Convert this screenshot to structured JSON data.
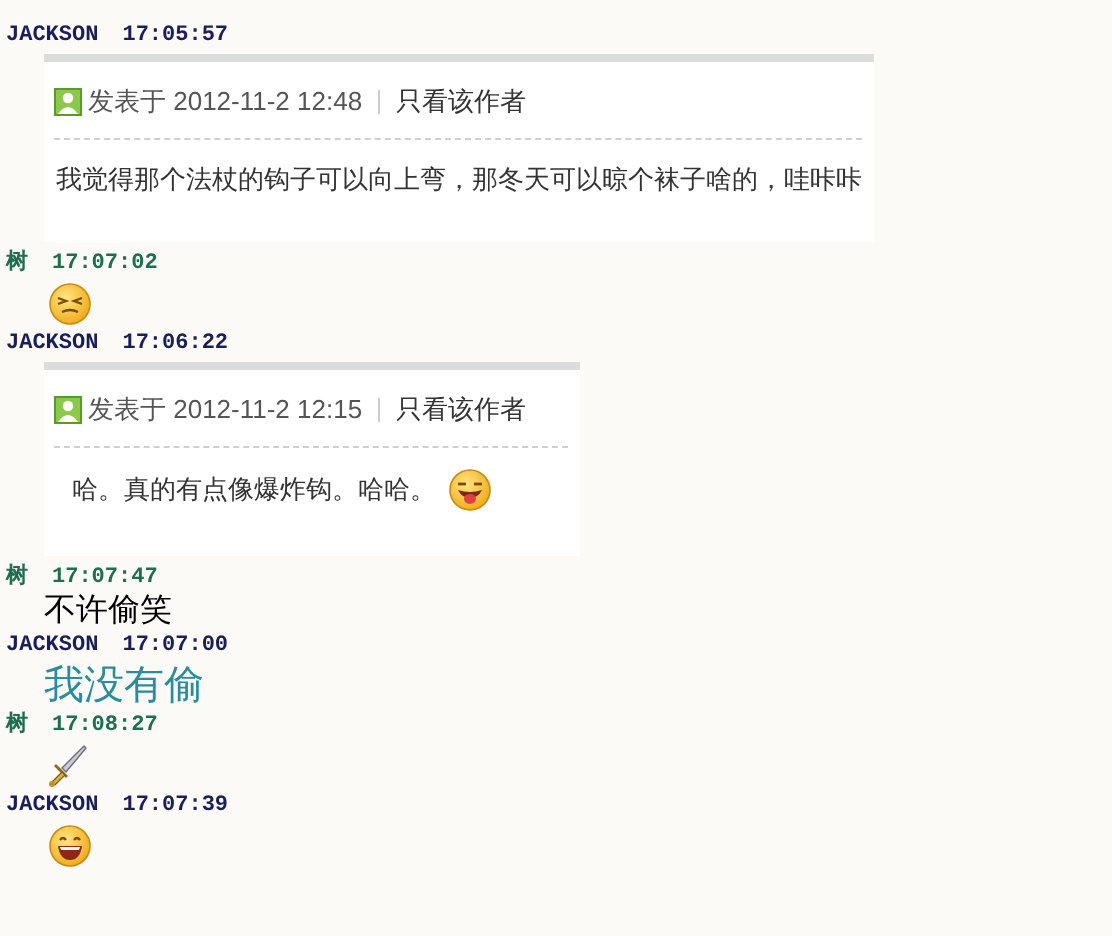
{
  "messages": [
    {
      "sender": "JACKSON",
      "time": "17:05:57",
      "color": "#1a1f5c",
      "kind": "quote",
      "posted": "发表于 2012-11-2 12:48",
      "author_link": "只看该作者",
      "body": "我觉得那个法杖的钩子可以向上弯，那冬天可以晾个袜子啥的，哇咔咔",
      "tongue_emoji": false
    },
    {
      "sender": "树",
      "time": "17:07:02",
      "color": "#1f6e4e",
      "kind": "squint"
    },
    {
      "sender": "JACKSON",
      "time": "17:06:22",
      "color": "#1a1f5c",
      "kind": "quote",
      "posted": "发表于 2012-11-2 12:15",
      "author_link": "只看该作者",
      "body": "哈。真的有点像爆炸钩。哈哈。",
      "tongue_emoji": true
    },
    {
      "sender": "树",
      "time": "17:07:47",
      "color": "#1f6e4e",
      "kind": "text",
      "text": "不许偷笑",
      "large": false
    },
    {
      "sender": "JACKSON",
      "time": "17:07:00",
      "color": "#1a1f5c",
      "kind": "text",
      "text": "我没有偷",
      "large": true
    },
    {
      "sender": "树",
      "time": "17:08:27",
      "color": "#1f6e4e",
      "kind": "sword"
    },
    {
      "sender": "JACKSON",
      "time": "17:07:39",
      "color": "#1a1f5c",
      "kind": "grin"
    }
  ]
}
